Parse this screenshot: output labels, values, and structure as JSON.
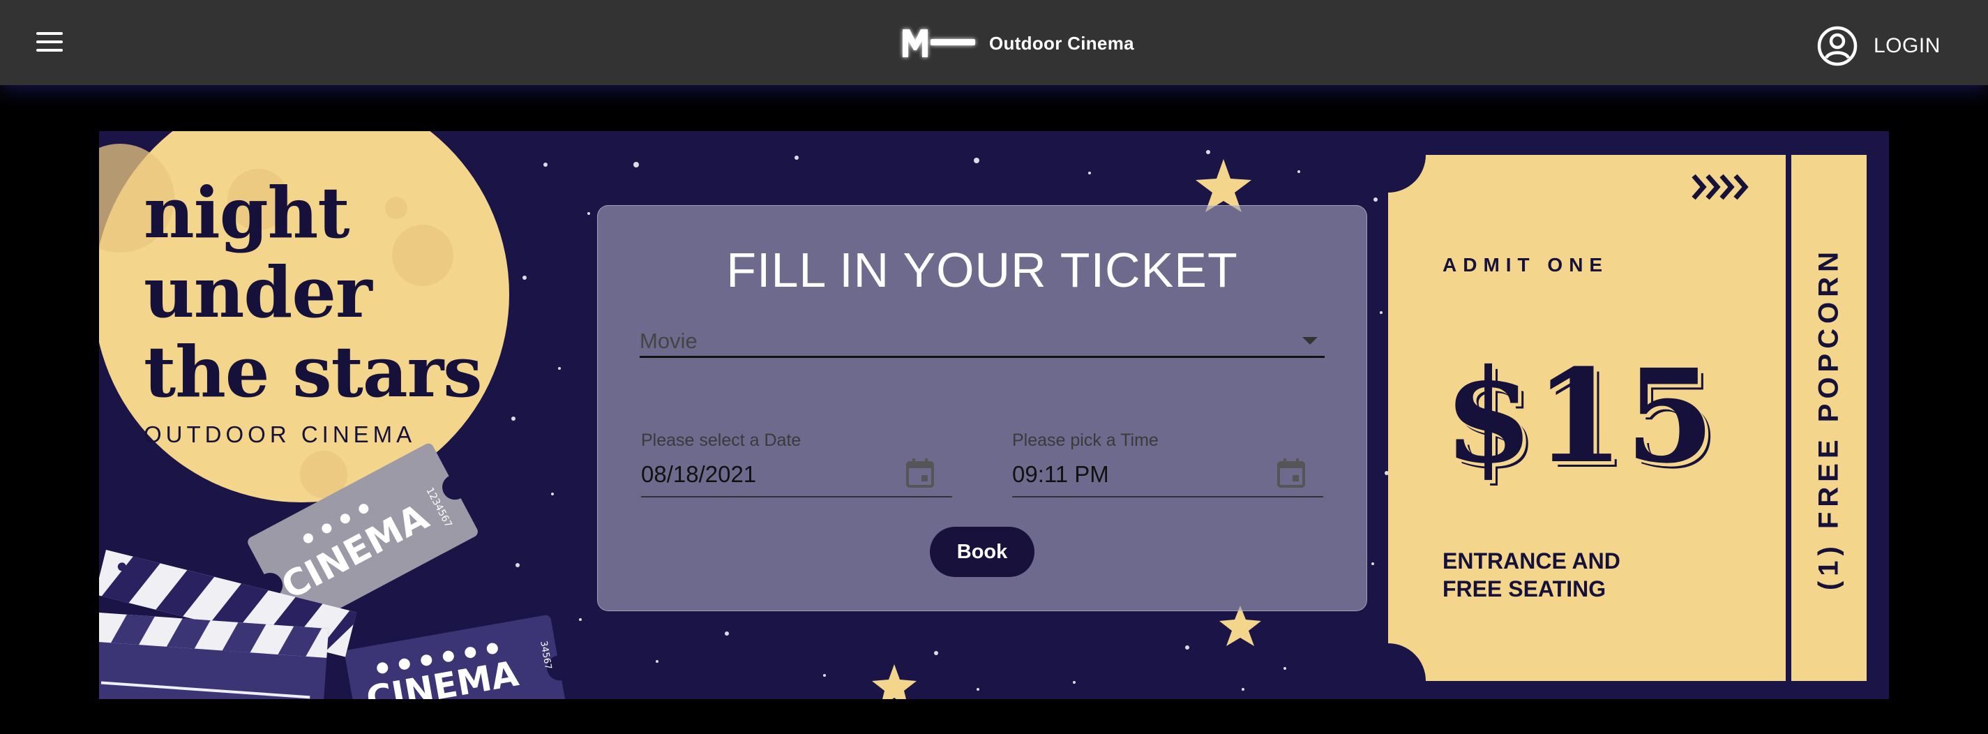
{
  "header": {
    "brand_name": "Outdoor Cinema",
    "logo_letter": "M",
    "login_label": "LOGIN",
    "menu_icon": "hamburger-icon",
    "login_icon": "account-circle-icon",
    "background_color": "#333333"
  },
  "banner": {
    "title_lines": [
      "night",
      "under",
      "the stars"
    ],
    "subtitle": "OUTDOOR CINEMA",
    "clapper_text": "CINEMA",
    "ticket_text": "CINEMA",
    "ticket_serial": "1234567",
    "colors": {
      "night": "#1b1446",
      "moon": "#f3d68c",
      "ink": "#16113a"
    }
  },
  "form": {
    "title": "FILL IN YOUR TICKET",
    "movie_label": "Movie",
    "date_label": "Please select a Date",
    "date_value": "08/18/2021",
    "time_label": "Please pick a Time",
    "time_value": "09:11 PM",
    "book_label": "Book"
  },
  "ticket": {
    "arrows": "››››",
    "admit": "ADMIT ONE",
    "price": "$15",
    "entrance_line1": "ENTRANCE AND",
    "entrance_line2": "FREE SEATING",
    "stub": "(1) FREE POPCORN"
  }
}
